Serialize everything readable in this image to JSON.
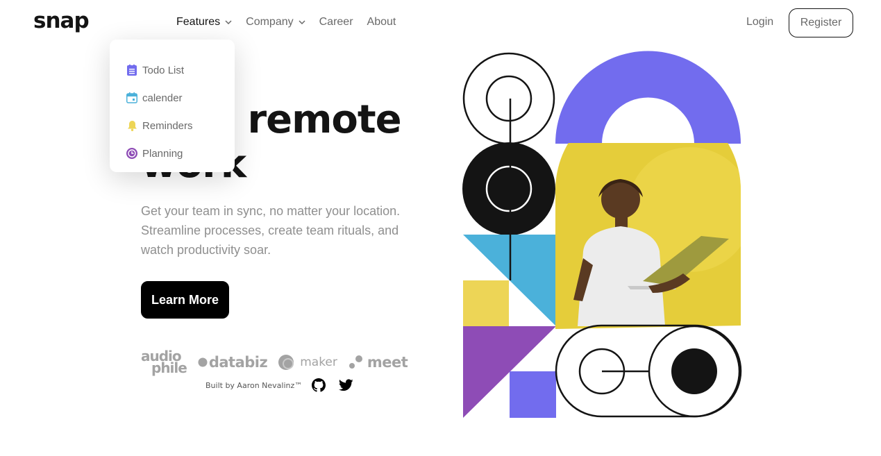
{
  "brand": {
    "logo_text": "snap"
  },
  "nav": {
    "items": [
      {
        "label": "Features",
        "has_dropdown": true,
        "active": true
      },
      {
        "label": "Company",
        "has_dropdown": true
      },
      {
        "label": "Career"
      },
      {
        "label": "About"
      }
    ],
    "login_label": "Login",
    "register_label": "Register"
  },
  "features_dropdown": {
    "items": [
      {
        "label": "Todo List",
        "icon": "todo-icon",
        "color": "#726CEE"
      },
      {
        "label": "calender",
        "icon": "calendar-icon",
        "color": "#4BB1DA"
      },
      {
        "label": "Reminders",
        "icon": "bell-icon",
        "color": "#EDD556"
      },
      {
        "label": "Planning",
        "icon": "planning-icon",
        "color": "#8E4CB6"
      }
    ]
  },
  "hero": {
    "headline_visible": "e remote",
    "headline_line2_visible": "work",
    "subtitle_lines": [
      "Get your team in sync, no matter your location.",
      "Streamline processes, create team rituals, and",
      "watch productivity soar."
    ],
    "cta_label": "Learn More"
  },
  "clients": {
    "audiophile_line1": "audio",
    "audiophile_line2": "phile",
    "databiz": "databiz",
    "maker": "maker",
    "meet": "meet"
  },
  "footer": {
    "credit": "Built by Aaron Nevalinz™",
    "icons": [
      "github-icon",
      "twitter-icon"
    ]
  },
  "colors": {
    "purple": "#726CEE",
    "blue": "#4BB1DA",
    "yellow": "#EDD556",
    "violet": "#8E4CB6",
    "almost_black": "#141414",
    "medium_gray": "#696969"
  }
}
